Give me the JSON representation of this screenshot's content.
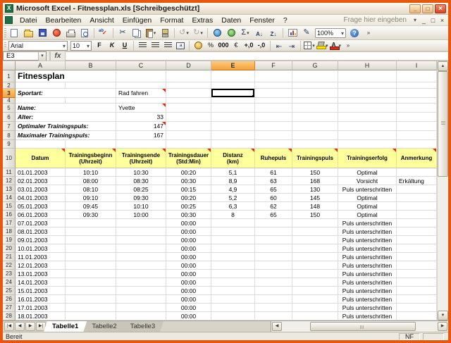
{
  "titlebar": {
    "title": "Microsoft Excel - Fitnessplan.xls  [Schreibgeschützt]"
  },
  "menubar": {
    "items": [
      "Datei",
      "Bearbeiten",
      "Ansicht",
      "Einfügen",
      "Format",
      "Extras",
      "Daten",
      "Fenster",
      "?"
    ],
    "question_placeholder": "Frage hier eingeben"
  },
  "standard_toolbar": [
    {
      "name": "new-icon",
      "kind": "page"
    },
    {
      "name": "open-icon",
      "kind": "folder"
    },
    {
      "name": "save-icon",
      "kind": "floppy"
    },
    {
      "name": "permission-icon",
      "kind": "permission"
    },
    {
      "name": "print-icon",
      "kind": "printer"
    },
    {
      "name": "print-preview-icon",
      "kind": "preview"
    },
    {
      "sep": true
    },
    {
      "name": "spelling-icon",
      "kind": "spelling"
    },
    {
      "sep": true
    },
    {
      "name": "cut-icon",
      "glyph": "✂"
    },
    {
      "name": "copy-icon",
      "kind": "copy"
    },
    {
      "name": "paste-icon",
      "kind": "paste",
      "dropdown": true
    },
    {
      "name": "format-painter-icon",
      "kind": "painter"
    },
    {
      "sep": true
    },
    {
      "name": "undo-icon",
      "glyph": "↺",
      "disabled": true,
      "dropdown": true
    },
    {
      "name": "redo-icon",
      "glyph": "↻",
      "disabled": true,
      "dropdown": true
    },
    {
      "sep": true
    },
    {
      "name": "hyperlink-icon",
      "kind": "hyperlink"
    },
    {
      "name": "research-icon",
      "kind": "research"
    },
    {
      "name": "autosum-icon",
      "glyph": "Σ",
      "dropdown": true
    },
    {
      "name": "sort-ascending-icon",
      "kind": "sortasc"
    },
    {
      "name": "sort-descending-icon",
      "kind": "sortdesc"
    },
    {
      "sep": true
    },
    {
      "name": "chart-wizard-icon",
      "kind": "chart"
    },
    {
      "name": "drawing-icon",
      "glyph": "✎"
    },
    {
      "name": "zoom-select",
      "kind": "zoom",
      "text": "100%"
    },
    {
      "name": "help-icon",
      "kind": "help"
    },
    {
      "name": "toolbar-options-icon",
      "kind": "options"
    }
  ],
  "formatting_toolbar": {
    "font_name": "Arial",
    "font_size": "10",
    "buttons": [
      {
        "name": "bold-button",
        "glyph": "F",
        "cls": "g-b"
      },
      {
        "name": "italic-button",
        "glyph": "K",
        "cls": "g-i"
      },
      {
        "name": "underline-button",
        "glyph": "U",
        "cls": "g-u"
      },
      {
        "sep": true
      },
      {
        "name": "align-left-icon",
        "kind": "align"
      },
      {
        "name": "align-center-icon",
        "kind": "align"
      },
      {
        "name": "align-right-icon",
        "kind": "align"
      },
      {
        "name": "merge-center-icon",
        "kind": "merge"
      },
      {
        "sep": true
      },
      {
        "name": "currency-icon",
        "kind": "coin"
      },
      {
        "name": "percent-icon",
        "glyph": "%"
      },
      {
        "name": "thousands-separator-icon",
        "glyph": "000",
        "small": true
      },
      {
        "name": "euro-icon",
        "glyph": "€"
      },
      {
        "name": "increase-decimal-icon",
        "glyph": "+,0",
        "small": true
      },
      {
        "name": "decrease-decimal-icon",
        "glyph": "-,0",
        "small": true
      },
      {
        "sep": true
      },
      {
        "name": "decrease-indent-icon",
        "kind": "inddec"
      },
      {
        "name": "increase-indent-icon",
        "kind": "indinc"
      },
      {
        "sep": true
      },
      {
        "name": "borders-icon",
        "kind": "borders",
        "dropdown": true
      },
      {
        "name": "fill-color-icon",
        "kind": "fill",
        "dropdown": true
      },
      {
        "name": "font-color-icon",
        "kind": "fontcol",
        "dropdown": true
      },
      {
        "name": "toolbar-options-icon",
        "kind": "options"
      }
    ]
  },
  "formula_bar": {
    "name_box": "E3",
    "fx_label": "fx"
  },
  "sheet": {
    "columns": [
      "A",
      "B",
      "C",
      "D",
      "E",
      "F",
      "G",
      "H",
      "I"
    ],
    "selection": {
      "cell": "E3",
      "column": "E",
      "row": 3
    },
    "rows": [
      {
        "n": 1,
        "h": 17,
        "type": "title",
        "text": "Fitnessplan"
      },
      {
        "n": 2,
        "h": 9,
        "type": "empty"
      },
      {
        "n": 3,
        "h": 13,
        "type": "info",
        "label": "Sportart:",
        "value": "Rad fahren",
        "align": "al",
        "comment": true
      },
      {
        "n": 4,
        "h": 8,
        "type": "empty"
      },
      {
        "n": 5,
        "h": 13,
        "type": "info",
        "label": "Name:",
        "value": "Yvette",
        "align": "al",
        "comment": true
      },
      {
        "n": 6,
        "h": 13,
        "type": "info",
        "label": "Alter:",
        "value": "33",
        "align": "ar",
        "comment": false
      },
      {
        "n": 7,
        "h": 13,
        "type": "info",
        "label": "Optimaler Trainingspuls:",
        "value": "147",
        "align": "ar",
        "comment": true
      },
      {
        "n": 8,
        "h": 13,
        "type": "info",
        "label": "Maximaler Trainingspuls:",
        "value": "167",
        "align": "ar",
        "comment": false
      },
      {
        "n": 9,
        "h": 12,
        "type": "empty"
      },
      {
        "n": 10,
        "h": 28,
        "type": "header",
        "cells": [
          "Datum",
          "Trainingsbeginn\n(Uhrzeit)",
          "Trainingsende\n(Uhrzeit)",
          "Trainingsdauer\n(Std:Min)",
          "Distanz\n(km)",
          "Ruhepuls",
          "Trainingspuls",
          "Trainingserfolg",
          "Anmerkung"
        ]
      },
      {
        "n": 11,
        "h": 12,
        "type": "data",
        "cells": [
          "01.01.2003",
          "10:10",
          "10:30",
          "00:20",
          "5,1",
          "61",
          "150",
          "Optimal",
          ""
        ]
      },
      {
        "n": 12,
        "h": 12,
        "type": "data",
        "cells": [
          "02.01.2003",
          "08:00",
          "08:30",
          "00:30",
          "8,9",
          "63",
          "168",
          "Vorsicht",
          "Erkältung"
        ]
      },
      {
        "n": 13,
        "h": 12,
        "type": "data",
        "cells": [
          "03.01.2003",
          "08:10",
          "08:25",
          "00:15",
          "4,9",
          "65",
          "130",
          "Puls unterschritten",
          ""
        ]
      },
      {
        "n": 14,
        "h": 12,
        "type": "data",
        "cells": [
          "04.01.2003",
          "09:10",
          "09:30",
          "00:20",
          "5,2",
          "60",
          "145",
          "Optimal",
          ""
        ]
      },
      {
        "n": 15,
        "h": 12,
        "type": "data",
        "cells": [
          "05.01.2003",
          "09:45",
          "10:10",
          "00:25",
          "6,3",
          "62",
          "148",
          "Optimal",
          ""
        ]
      },
      {
        "n": 16,
        "h": 12,
        "type": "data",
        "cells": [
          "06.01.2003",
          "09:30",
          "10:00",
          "00:30",
          "8",
          "65",
          "150",
          "Optimal",
          ""
        ]
      },
      {
        "n": 17,
        "h": 12,
        "type": "data",
        "cells": [
          "07.01.2003",
          "",
          "",
          "00:00",
          "",
          "",
          "",
          "Puls unterschritten",
          ""
        ]
      },
      {
        "n": 18,
        "h": 12,
        "type": "data",
        "cells": [
          "08.01.2003",
          "",
          "",
          "00:00",
          "",
          "",
          "",
          "Puls unterschritten",
          ""
        ]
      },
      {
        "n": 19,
        "h": 12,
        "type": "data",
        "cells": [
          "09.01.2003",
          "",
          "",
          "00:00",
          "",
          "",
          "",
          "Puls unterschritten",
          ""
        ]
      },
      {
        "n": 20,
        "h": 12,
        "type": "data",
        "cells": [
          "10.01.2003",
          "",
          "",
          "00:00",
          "",
          "",
          "",
          "Puls unterschritten",
          ""
        ]
      },
      {
        "n": 21,
        "h": 12,
        "type": "data",
        "cells": [
          "11.01.2003",
          "",
          "",
          "00:00",
          "",
          "",
          "",
          "Puls unterschritten",
          ""
        ]
      },
      {
        "n": 22,
        "h": 12,
        "type": "data",
        "cells": [
          "12.01.2003",
          "",
          "",
          "00:00",
          "",
          "",
          "",
          "Puls unterschritten",
          ""
        ]
      },
      {
        "n": 23,
        "h": 12,
        "type": "data",
        "cells": [
          "13.01.2003",
          "",
          "",
          "00:00",
          "",
          "",
          "",
          "Puls unterschritten",
          ""
        ]
      },
      {
        "n": 24,
        "h": 12,
        "type": "data",
        "cells": [
          "14.01.2003",
          "",
          "",
          "00:00",
          "",
          "",
          "",
          "Puls unterschritten",
          ""
        ]
      },
      {
        "n": 25,
        "h": 12,
        "type": "data",
        "cells": [
          "15.01.2003",
          "",
          "",
          "00:00",
          "",
          "",
          "",
          "Puls unterschritten",
          ""
        ]
      },
      {
        "n": 26,
        "h": 12,
        "type": "data",
        "cells": [
          "16.01.2003",
          "",
          "",
          "00:00",
          "",
          "",
          "",
          "Puls unterschritten",
          ""
        ]
      },
      {
        "n": 27,
        "h": 12,
        "type": "data",
        "cells": [
          "17.01.2003",
          "",
          "",
          "00:00",
          "",
          "",
          "",
          "Puls unterschritten",
          ""
        ]
      },
      {
        "n": 28,
        "h": 12,
        "type": "data",
        "cells": [
          "18.01.2003",
          "",
          "",
          "00:00",
          "",
          "",
          "",
          "Puls unterschritten",
          ""
        ]
      }
    ]
  },
  "sheet_tabs": {
    "tabs": [
      "Tabelle1",
      "Tabelle2",
      "Tabelle3"
    ],
    "active": "Tabelle1",
    "nav": [
      {
        "name": "tab-first-button",
        "glyph": "|◀"
      },
      {
        "name": "tab-prev-button",
        "glyph": "◀"
      },
      {
        "name": "tab-next-button",
        "glyph": "▶"
      },
      {
        "name": "tab-last-button",
        "glyph": "▶|"
      }
    ]
  },
  "status_bar": {
    "mode": "Bereit",
    "nf": "NF"
  }
}
